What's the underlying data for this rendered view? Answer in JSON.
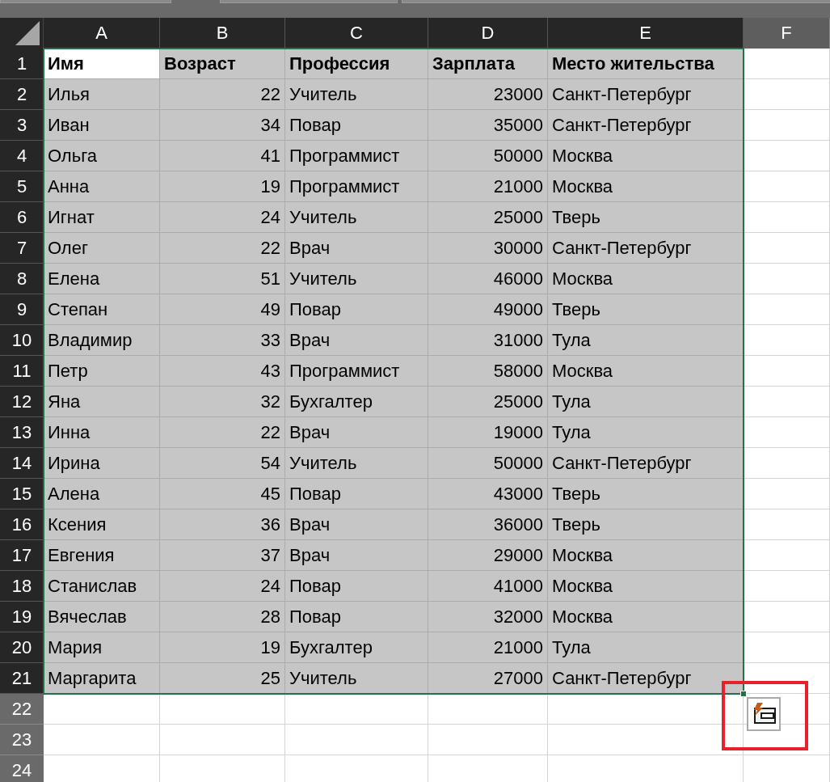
{
  "columns": [
    {
      "label": "A",
      "selected": true,
      "active": true,
      "kind": "text"
    },
    {
      "label": "B",
      "selected": true,
      "active": false,
      "kind": "number"
    },
    {
      "label": "C",
      "selected": true,
      "active": false,
      "kind": "text"
    },
    {
      "label": "D",
      "selected": true,
      "active": false,
      "kind": "number"
    },
    {
      "label": "E",
      "selected": true,
      "active": false,
      "kind": "text"
    },
    {
      "label": "F",
      "selected": false,
      "active": false
    }
  ],
  "rows": [
    {
      "number": "1",
      "selected": true,
      "active": true,
      "kind": "header",
      "cells": [
        "Имя",
        "Возраст",
        "Профессия",
        "Зарплата",
        "Место жительства"
      ]
    },
    {
      "number": "2",
      "selected": true,
      "kind": "data",
      "cells": [
        "Илья",
        "22",
        "Учитель",
        "23000",
        "Санкт-Петербург"
      ]
    },
    {
      "number": "3",
      "selected": true,
      "kind": "data",
      "cells": [
        "Иван",
        "34",
        "Повар",
        "35000",
        "Санкт-Петербург"
      ]
    },
    {
      "number": "4",
      "selected": true,
      "kind": "data",
      "cells": [
        "Ольга",
        "41",
        "Программист",
        "50000",
        "Москва"
      ]
    },
    {
      "number": "5",
      "selected": true,
      "kind": "data",
      "cells": [
        "Анна",
        "19",
        "Программист",
        "21000",
        "Москва"
      ]
    },
    {
      "number": "6",
      "selected": true,
      "kind": "data",
      "cells": [
        "Игнат",
        "24",
        "Учитель",
        "25000",
        "Тверь"
      ]
    },
    {
      "number": "7",
      "selected": true,
      "kind": "data",
      "cells": [
        "Олег",
        "22",
        "Врач",
        "30000",
        "Санкт-Петербург"
      ]
    },
    {
      "number": "8",
      "selected": true,
      "kind": "data",
      "cells": [
        "Елена",
        "51",
        "Учитель",
        "46000",
        "Москва"
      ]
    },
    {
      "number": "9",
      "selected": true,
      "kind": "data",
      "cells": [
        "Степан",
        "49",
        "Повар",
        "49000",
        "Тверь"
      ]
    },
    {
      "number": "10",
      "selected": true,
      "kind": "data",
      "cells": [
        "Владимир",
        "33",
        "Врач",
        "31000",
        "Тула"
      ]
    },
    {
      "number": "11",
      "selected": true,
      "kind": "data",
      "cells": [
        "Петр",
        "43",
        "Программист",
        "58000",
        "Москва"
      ]
    },
    {
      "number": "12",
      "selected": true,
      "kind": "data",
      "cells": [
        "Яна",
        "32",
        "Бухгалтер",
        "25000",
        "Тула"
      ]
    },
    {
      "number": "13",
      "selected": true,
      "kind": "data",
      "cells": [
        "Инна",
        "22",
        "Врач",
        "19000",
        "Тула"
      ]
    },
    {
      "number": "14",
      "selected": true,
      "kind": "data",
      "cells": [
        "Ирина",
        "54",
        "Учитель",
        "50000",
        "Санкт-Петербург"
      ]
    },
    {
      "number": "15",
      "selected": true,
      "kind": "data",
      "cells": [
        "Алена",
        "45",
        "Повар",
        "43000",
        "Тверь"
      ]
    },
    {
      "number": "16",
      "selected": true,
      "kind": "data",
      "cells": [
        "Ксения",
        "36",
        "Врач",
        "36000",
        "Тверь"
      ]
    },
    {
      "number": "17",
      "selected": true,
      "kind": "data",
      "cells": [
        "Евгения",
        "37",
        "Врач",
        "29000",
        "Москва"
      ]
    },
    {
      "number": "18",
      "selected": true,
      "kind": "data",
      "cells": [
        "Станислав",
        "24",
        "Повар",
        "41000",
        "Москва"
      ]
    },
    {
      "number": "19",
      "selected": true,
      "kind": "data",
      "cells": [
        "Вячеслав",
        "28",
        "Повар",
        "32000",
        "Москва"
      ]
    },
    {
      "number": "20",
      "selected": true,
      "kind": "data",
      "cells": [
        "Мария",
        "19",
        "Бухгалтер",
        "21000",
        "Тула"
      ]
    },
    {
      "number": "21",
      "selected": true,
      "kind": "data",
      "cells": [
        "Маргарита",
        "25",
        "Учитель",
        "27000",
        "Санкт-Петербург"
      ]
    },
    {
      "number": "22",
      "selected": false,
      "cells": []
    },
    {
      "number": "23",
      "selected": false,
      "cells": []
    },
    {
      "number": "24",
      "selected": false,
      "cells": []
    }
  ],
  "quick_analysis": {
    "highlighted": true
  }
}
